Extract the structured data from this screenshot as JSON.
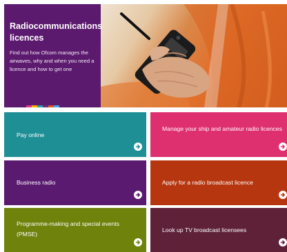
{
  "hero": {
    "title": "Radiocommunications licences",
    "description": "Find out how Ofcom manages the airwaves, why and when you need a licence and how to get one",
    "strip_colors": [
      "#e23a7f",
      "#f5b400",
      "#2aa4a0",
      "#6a2a85",
      "#e2581f",
      "#4aa3df"
    ]
  },
  "tiles": [
    {
      "label": "Pay online",
      "color": "#1f8f96",
      "icon": "arrow-right-circle-icon"
    },
    {
      "label": "Manage your ship and amateur radio licences",
      "color": "#de2f6f",
      "icon": "arrow-right-circle-icon"
    },
    {
      "label": "Business radio",
      "color": "#5a1a70",
      "icon": "arrow-right-circle-icon"
    },
    {
      "label": "Apply for a radio broadcast licence",
      "color": "#b6360f",
      "icon": "arrow-right-circle-icon"
    },
    {
      "label": "Programme-making and special events (PMSE)",
      "color": "#6e820c",
      "icon": "arrow-right-circle-icon"
    },
    {
      "label": "Look up TV broadcast licensees",
      "color": "#5e2138",
      "icon": "arrow-right-circle-icon"
    }
  ]
}
